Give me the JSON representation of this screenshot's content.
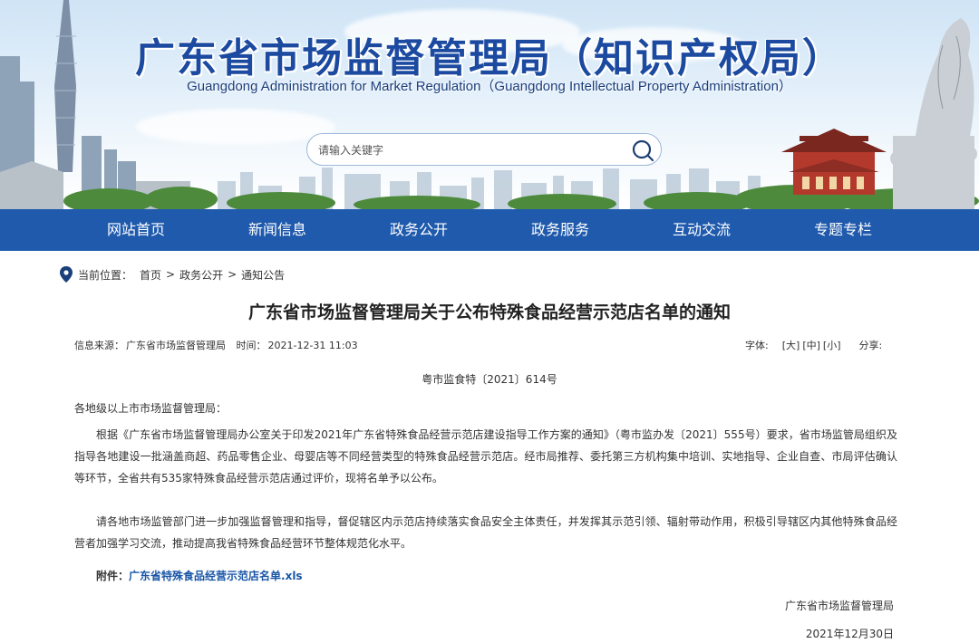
{
  "header": {
    "title": "广东省市场监督管理局（知识产权局）",
    "subtitle": "Guangdong Administration for Market Regulation（Guangdong Intellectual Property Administration）"
  },
  "search": {
    "placeholder": "请输入关键字",
    "icon": "search-icon"
  },
  "nav": {
    "items": [
      "网站首页",
      "新闻信息",
      "政务公开",
      "政务服务",
      "互动交流",
      "专题专栏"
    ]
  },
  "breadcrumb": {
    "label": "当前位置：",
    "items": [
      "首页",
      "政务公开",
      "通知公告"
    ],
    "separator": ">"
  },
  "article": {
    "title": "广东省市场监督管理局关于公布特殊食品经营示范店名单的通知",
    "meta": {
      "source_label": "信息来源：",
      "source": "广东省市场监督管理局",
      "time_label": "时间：",
      "time": "2021-12-31 11:03",
      "font_label": "字体:",
      "font_sizes": [
        "[大]",
        "[中]",
        "[小]"
      ],
      "share_label": "分享:"
    },
    "doc_number": "粤市监食特〔2021〕614号",
    "salutation": "各地级以上市市场监督管理局：",
    "paragraphs": [
      "根据《广东省市场监督管理局办公室关于印发2021年广东省特殊食品经营示范店建设指导工作方案的通知》（粤市监办发〔2021〕555号）要求，省市场监管局组织及指导各地建设一批涵盖商超、药品零售企业、母婴店等不同经营类型的特殊食品经营示范店。经市局推荐、委托第三方机构集中培训、实地指导、企业自查、市局评估确认等环节，全省共有535家特殊食品经营示范店通过评价，现将名单予以公布。",
      "请各地市场监管部门进一步加强监督管理和指导，督促辖区内示范店持续落实食品安全主体责任，并发挥其示范引领、辐射带动作用，积极引导辖区内其他特殊食品经营者加强学习交流，推动提高我省特殊食品经营环节整体规范化水平。"
    ],
    "attachment_label": "附件：",
    "attachment_link": "广东省特殊食品经营示范店名单.xls",
    "signature": "广东省市场监督管理局",
    "sign_date": "2021年12月30日"
  },
  "colors": {
    "nav_bg": "#1f5aad",
    "title_blue": "#1b4aa0",
    "link_blue": "#1a56a7"
  }
}
